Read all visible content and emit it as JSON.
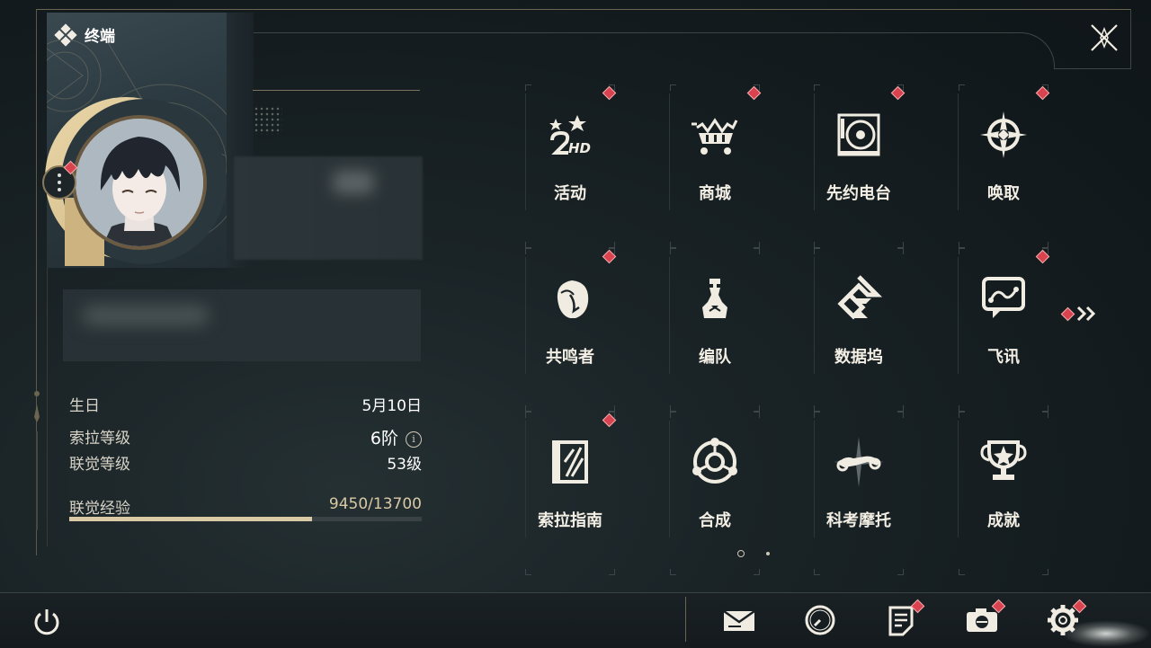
{
  "header": {
    "title": "终端"
  },
  "profile": {
    "birthday_label": "生日",
    "birthday_value": "5月10日",
    "sora_level_label": "索拉等级",
    "sora_level_value": "6阶",
    "info_icon_glyph": "i",
    "union_level_label": "联觉等级",
    "union_level_value": "53级",
    "union_exp_label": "联觉经验",
    "union_exp_value": "9450/13700",
    "union_exp_progress": 0.69
  },
  "grid": {
    "tiles": [
      {
        "label": "活动",
        "icon": "events-2nd-anniversary-icon",
        "badge": true
      },
      {
        "label": "商城",
        "icon": "shop-cart-icon",
        "badge": true
      },
      {
        "label": "先约电台",
        "icon": "radio-turntable-icon",
        "badge": true
      },
      {
        "label": "唤取",
        "icon": "compass-star-icon",
        "badge": true
      },
      {
        "label": "共鸣者",
        "icon": "resonator-portrait-icon",
        "badge": true
      },
      {
        "label": "编队",
        "icon": "chess-team-icon",
        "badge": false
      },
      {
        "label": "数据坞",
        "icon": "data-dock-icon",
        "badge": false
      },
      {
        "label": "飞讯",
        "icon": "message-chat-icon",
        "badge": true
      },
      {
        "label": "索拉指南",
        "icon": "guide-book-icon",
        "badge": true
      },
      {
        "label": "合成",
        "icon": "synthesis-icon",
        "badge": false
      },
      {
        "label": "科考摩托",
        "icon": "motorcycle-icon",
        "badge": false
      },
      {
        "label": "成就",
        "icon": "achievement-trophy-icon",
        "badge": false
      }
    ],
    "next_page_icon": "double-chevron-right-icon",
    "pages": 2,
    "current_page": 1
  },
  "bottom_bar": {
    "items": [
      {
        "icon": "mail-icon",
        "badge": false
      },
      {
        "icon": "clock-icon",
        "badge": false
      },
      {
        "icon": "notice-icon",
        "badge": true
      },
      {
        "icon": "camera-icon",
        "badge": true
      },
      {
        "icon": "settings-gear-icon",
        "badge": true
      }
    ]
  },
  "colors": {
    "accent_gold": "#cdb380",
    "badge_red": "#d8434f",
    "text": "#f3efe5"
  }
}
